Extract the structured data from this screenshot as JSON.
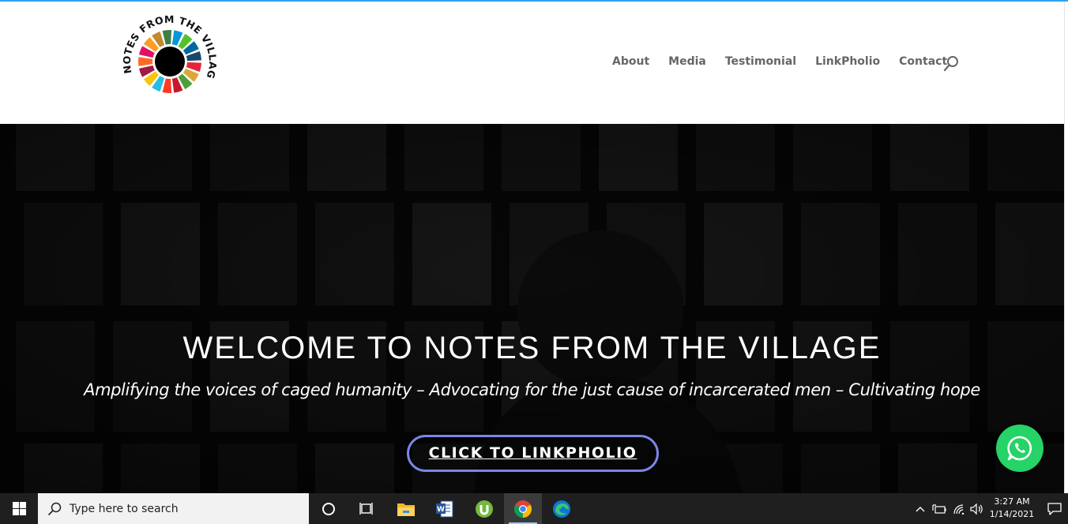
{
  "site": {
    "logo_text": "NOTES FROM THE VILLAGE",
    "nav": [
      {
        "label": "About"
      },
      {
        "label": "Media"
      },
      {
        "label": "Testimonial"
      },
      {
        "label": "LinkPholio"
      },
      {
        "label": "Contact"
      }
    ],
    "search_icon": "search-icon"
  },
  "hero": {
    "title": "WELCOME TO NOTES FROM THE VILLAGE",
    "subtitle": "Amplifying the voices of caged humanity – Advocating for the just cause of incarcerated men – Cultivating hope",
    "button_label": "CLICK TO LINKPHOLIO",
    "whatsapp_icon": "whatsapp-icon"
  },
  "taskbar": {
    "search_placeholder": "Type here to search",
    "apps": [
      "cortana-icon",
      "task-view-icon",
      "file-explorer-icon",
      "word-icon",
      "utorrent-icon",
      "chrome-icon",
      "edge-icon"
    ],
    "tray": [
      "chevron-up-icon",
      "battery-icon",
      "wifi-icon",
      "volume-icon"
    ],
    "time": "3:27 AM",
    "date": "1/14/2021"
  },
  "colors": {
    "accent": "#2ea3f2",
    "button_border": "#7b86e6",
    "whatsapp": "#25d366",
    "taskbar": "#1f1f1f"
  }
}
